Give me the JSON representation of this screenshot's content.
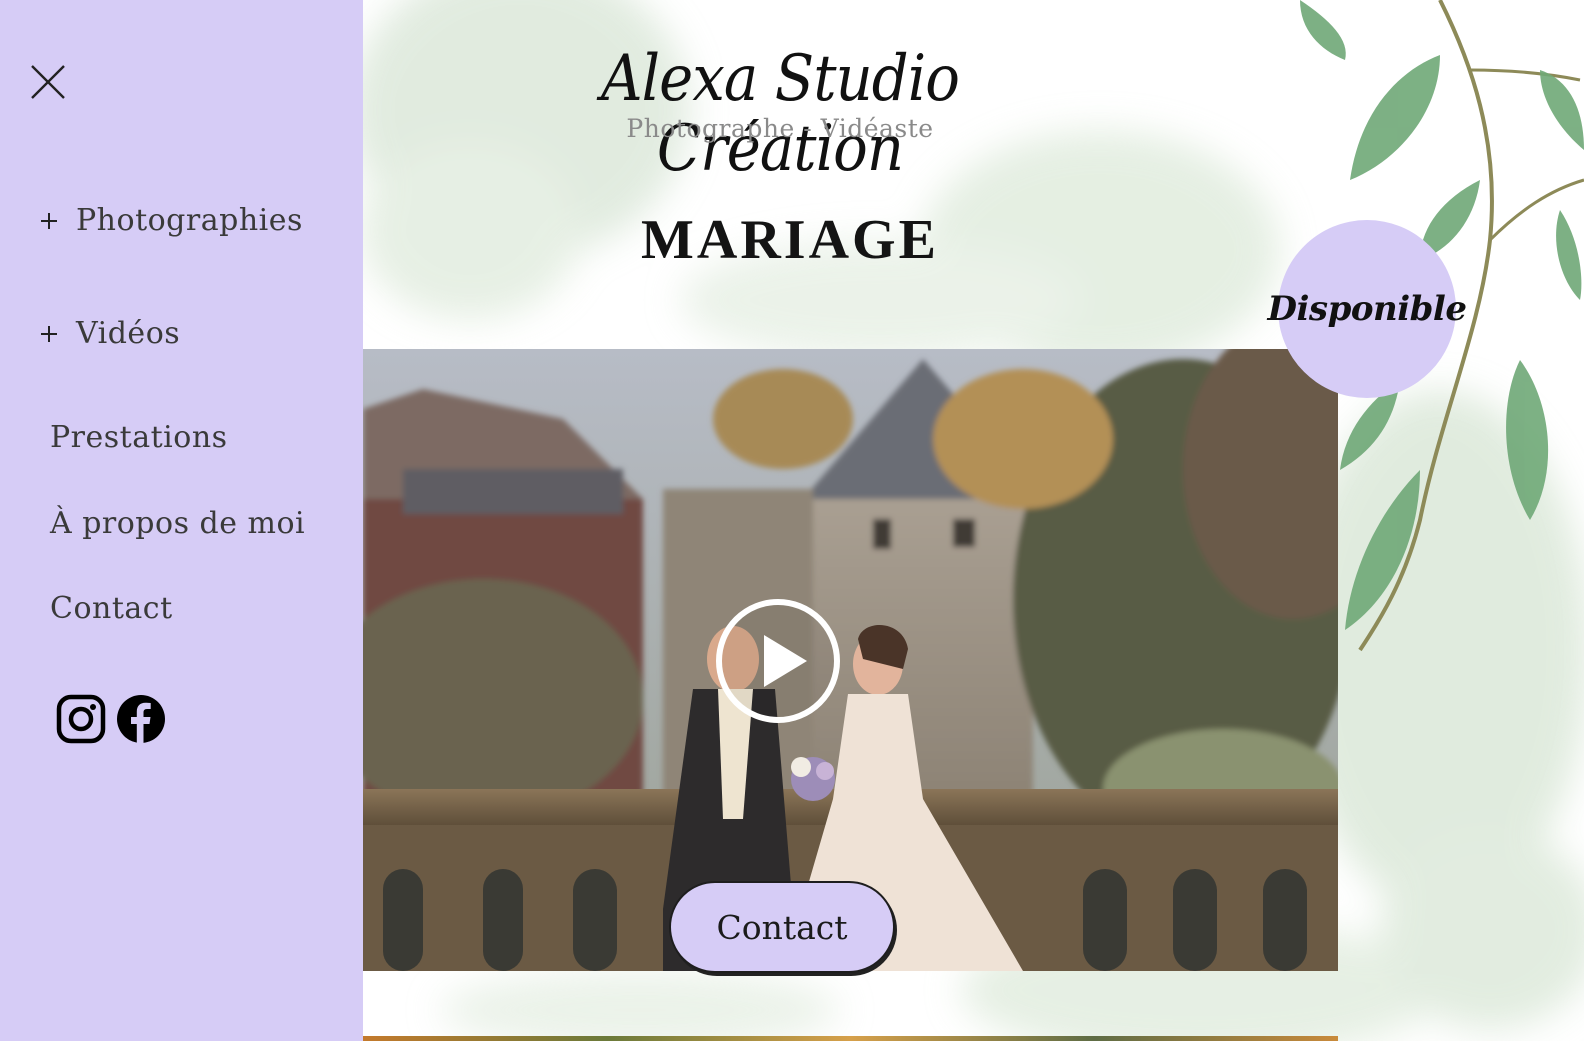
{
  "brand": {
    "title": "Alexa Studio Création",
    "subtitle": "Photographe - Vidéaste"
  },
  "page": {
    "title": "MARIAGE"
  },
  "badge": {
    "label": "Disponible"
  },
  "menu": {
    "close_icon": "close-icon",
    "items": [
      {
        "label": "Photographies",
        "expandable": true
      },
      {
        "label": "Vidéos",
        "expandable": true
      },
      {
        "label": "Prestations",
        "expandable": false
      },
      {
        "label": "À propos de moi",
        "expandable": false
      },
      {
        "label": "Contact",
        "expandable": false
      }
    ],
    "social": [
      {
        "icon": "instagram-icon"
      },
      {
        "icon": "facebook-icon"
      }
    ]
  },
  "hero": {
    "play_icon": "play-icon",
    "cta_label": "Contact"
  },
  "colors": {
    "accent": "#d6ccf6",
    "text_dark": "#1a1a1a",
    "subtitle_gray": "#8a8a8a",
    "leaf_green": "#5f9a6a"
  }
}
